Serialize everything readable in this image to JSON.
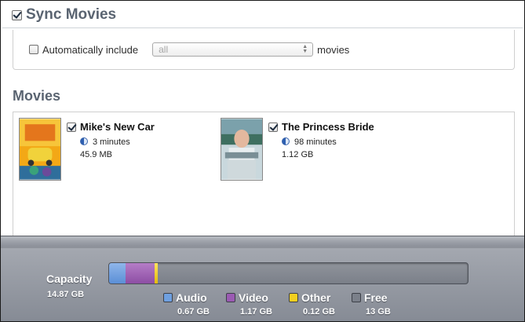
{
  "sync": {
    "title": "Sync Movies",
    "checked": true
  },
  "include": {
    "label": "Automatically include",
    "checked": false,
    "select_value": "all",
    "suffix": "movies"
  },
  "movies": {
    "heading": "Movies",
    "items": [
      {
        "title": "Mike's New Car",
        "duration": "3 minutes",
        "size": "45.9 MB",
        "checked": true
      },
      {
        "title": "The Princess Bride",
        "duration": "98 minutes",
        "size": "1.12 GB",
        "checked": true
      }
    ]
  },
  "capacity": {
    "label": "Capacity",
    "total": "14.87 GB",
    "legend": [
      {
        "name": "Audio",
        "value": "0.67 GB",
        "color": "#6fa0e0"
      },
      {
        "name": "Video",
        "value": "1.17 GB",
        "color": "#9b5bb3"
      },
      {
        "name": "Other",
        "value": "0.12 GB",
        "color": "#f2cf1f"
      },
      {
        "name": "Free",
        "value": "13 GB",
        "color": "#7b808a"
      }
    ]
  }
}
